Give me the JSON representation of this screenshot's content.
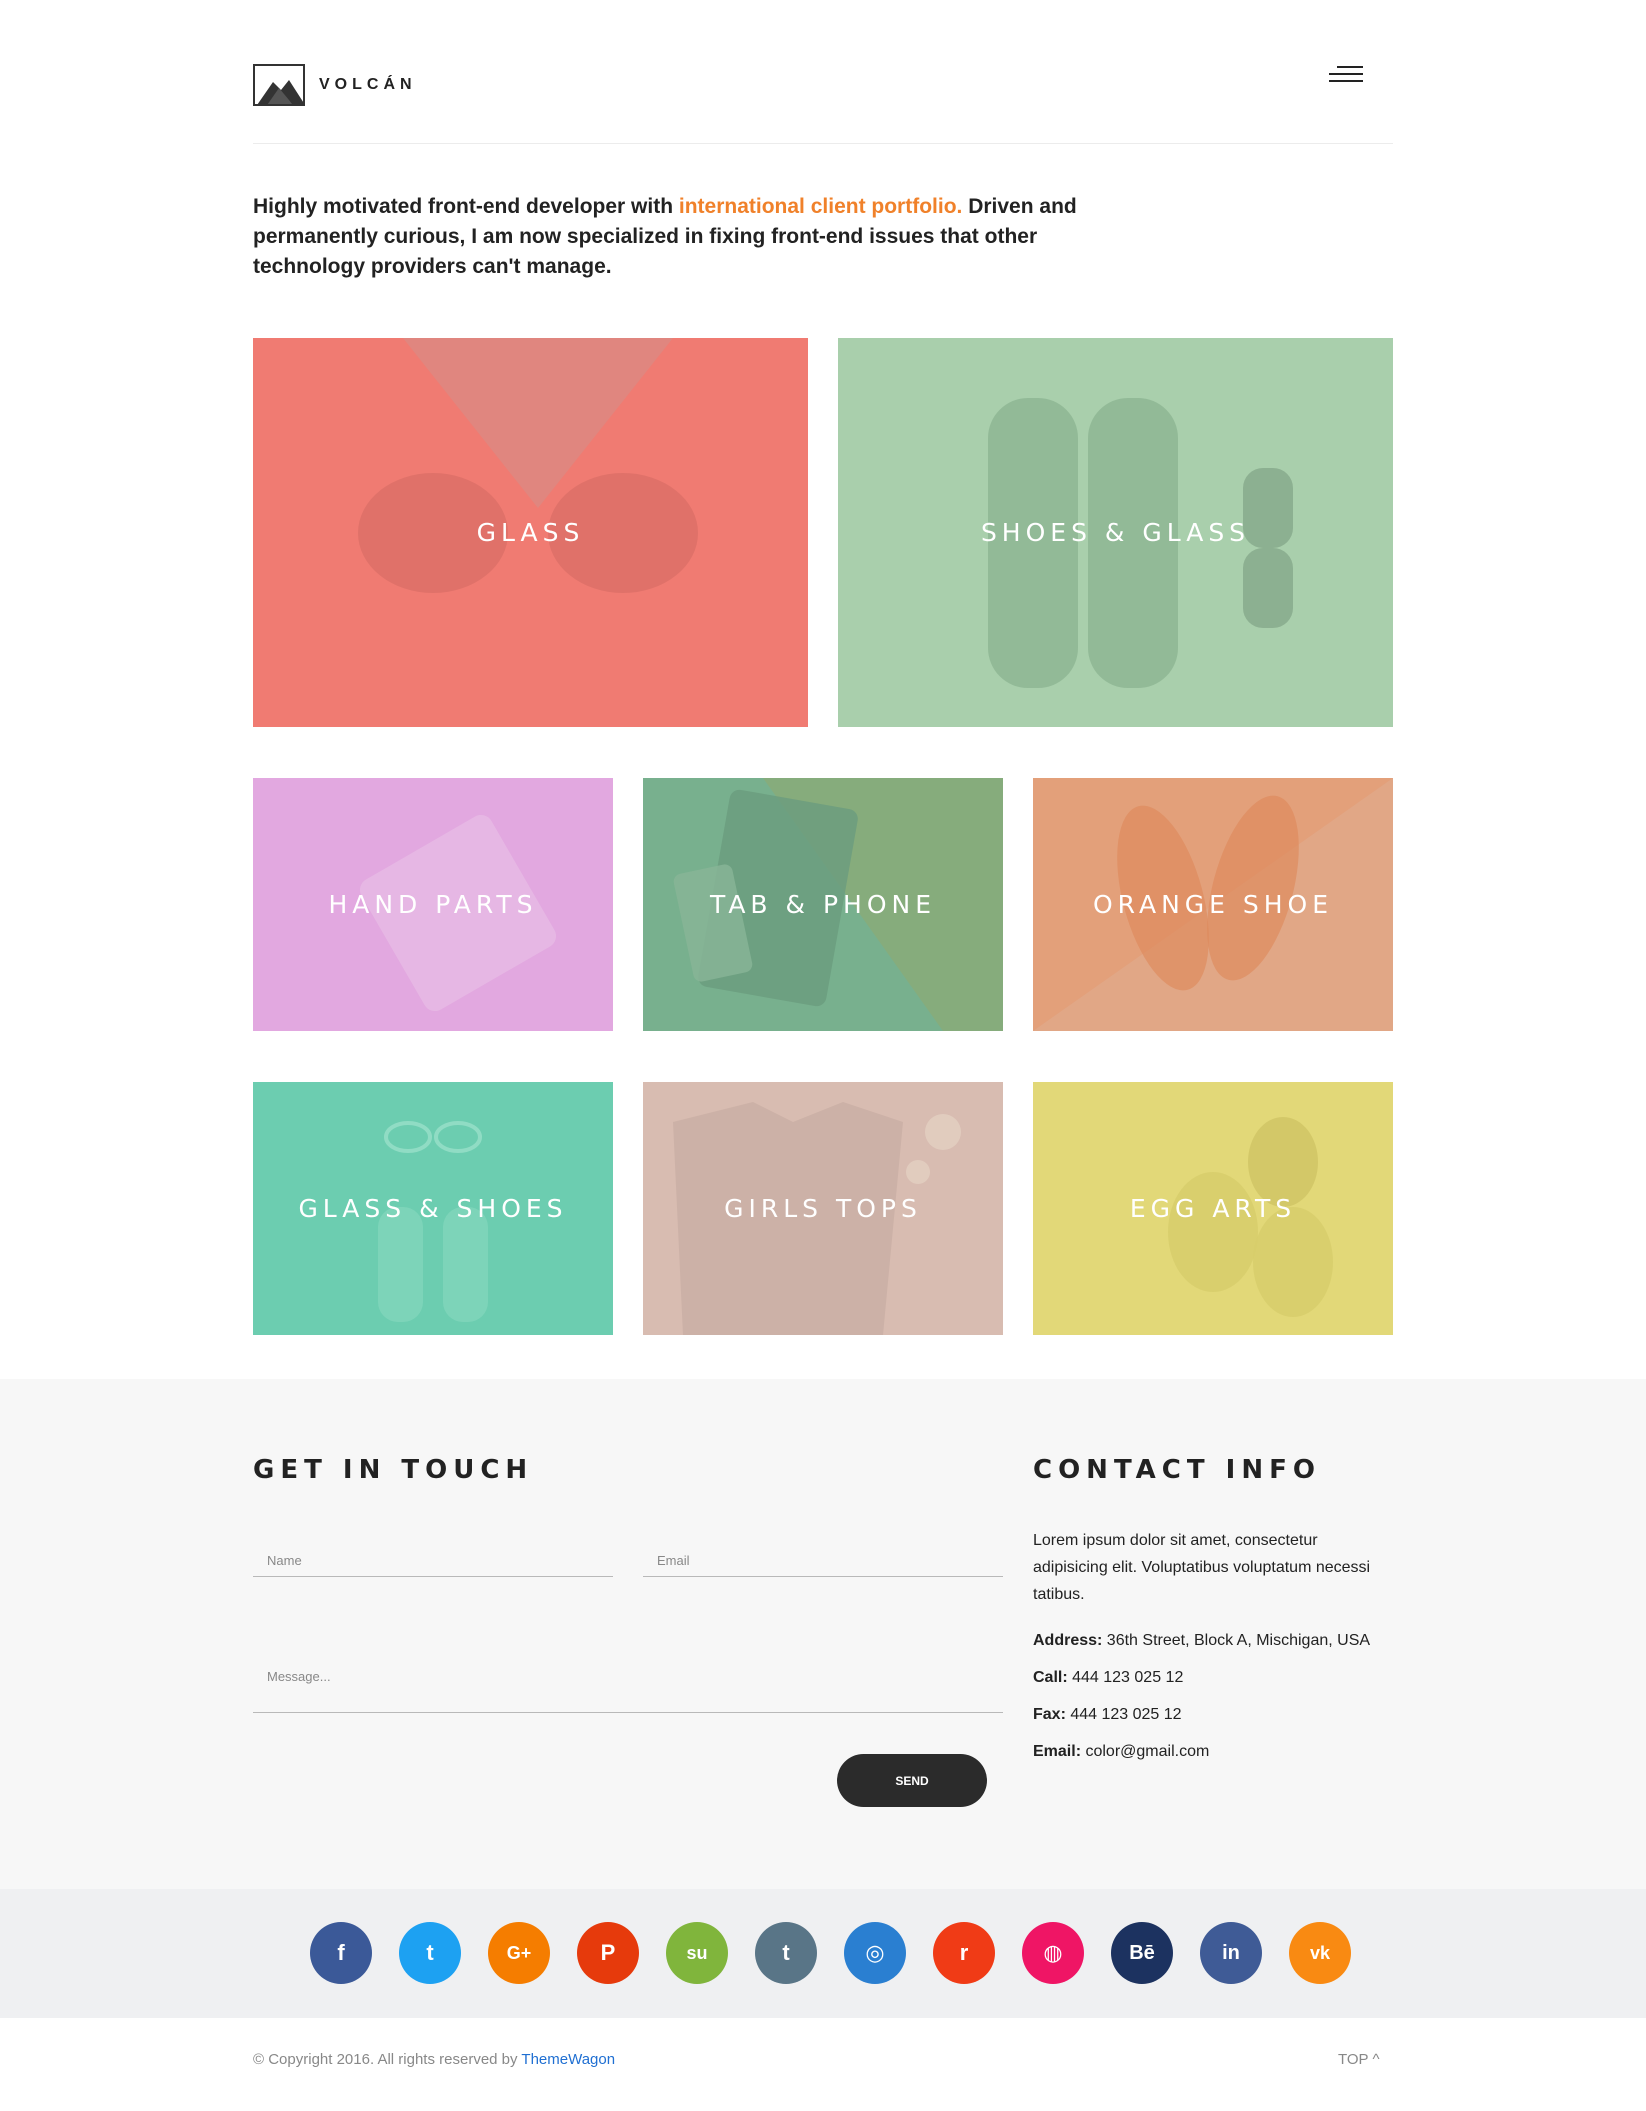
{
  "header": {
    "brand": "VOLCÁN"
  },
  "intro": {
    "before": "Highly motivated front-end developer with ",
    "highlight": "international client portfolio.",
    "after": " Driven and permanently curious, I am now specialized in fixing front-end issues that other technology providers can't manage."
  },
  "portfolio": [
    {
      "label": "GLASS",
      "color": "#f07b72"
    },
    {
      "label": "SHOES & GLASS",
      "color": "#a9cfac"
    },
    {
      "label": "HAND PARTS",
      "color": "#e2a8e0"
    },
    {
      "label": "TAB & PHONE",
      "color": "#78b08e"
    },
    {
      "label": "ORANGE SHOE",
      "color": "#e3a07a"
    },
    {
      "label": "GLASS & SHOES",
      "color": "#6ccdb0"
    },
    {
      "label": "GIRLS TOPS",
      "color": "#d8bcb1"
    },
    {
      "label": "EGG ARTS",
      "color": "#e2d878"
    }
  ],
  "contact": {
    "title": "GET IN TOUCH",
    "name_placeholder": "Name",
    "email_placeholder": "Email",
    "message_placeholder": "Message...",
    "send_label": "SEND"
  },
  "info": {
    "title": "CONTACT INFO",
    "text": "Lorem ipsum dolor sit amet, consectetur adipisicing elit. Voluptatibus voluptatum necessi tatibus.",
    "address_label": "Address:",
    "address": " 36th Street, Block A, Mischigan, USA",
    "call_label": "Call:",
    "call": " 444 123 025 12",
    "fax_label": "Fax:",
    "fax": " 444 123 025 12",
    "email_label": "Email:",
    "email": " color@gmail.com"
  },
  "social": [
    {
      "name": "facebook-icon",
      "glyph": "f",
      "color": "#3b5998"
    },
    {
      "name": "twitter-icon",
      "glyph": "t",
      "color": "#1da1f2"
    },
    {
      "name": "google-plus-icon",
      "glyph": "G+",
      "color": "#f57d00"
    },
    {
      "name": "pinterest-icon",
      "glyph": "P",
      "color": "#e63a0c"
    },
    {
      "name": "stumbleupon-icon",
      "glyph": "su",
      "color": "#80b53c"
    },
    {
      "name": "tumblr-icon",
      "glyph": "t",
      "color": "#597587"
    },
    {
      "name": "instagram-icon",
      "glyph": "◎",
      "color": "#2a7fd1"
    },
    {
      "name": "reddit-icon",
      "glyph": "r",
      "color": "#f03b16"
    },
    {
      "name": "dribbble-icon",
      "glyph": "◍",
      "color": "#ef1565"
    },
    {
      "name": "behance-icon",
      "glyph": "Bē",
      "color": "#1c3260"
    },
    {
      "name": "linkedin-icon",
      "glyph": "in",
      "color": "#3f5b96"
    },
    {
      "name": "vk-icon",
      "glyph": "vk",
      "color": "#f98a12"
    }
  ],
  "footer": {
    "copyright": "© Copyright 2016. All rights reserved by ",
    "link": "ThemeWagon",
    "top": "TOP ^"
  }
}
